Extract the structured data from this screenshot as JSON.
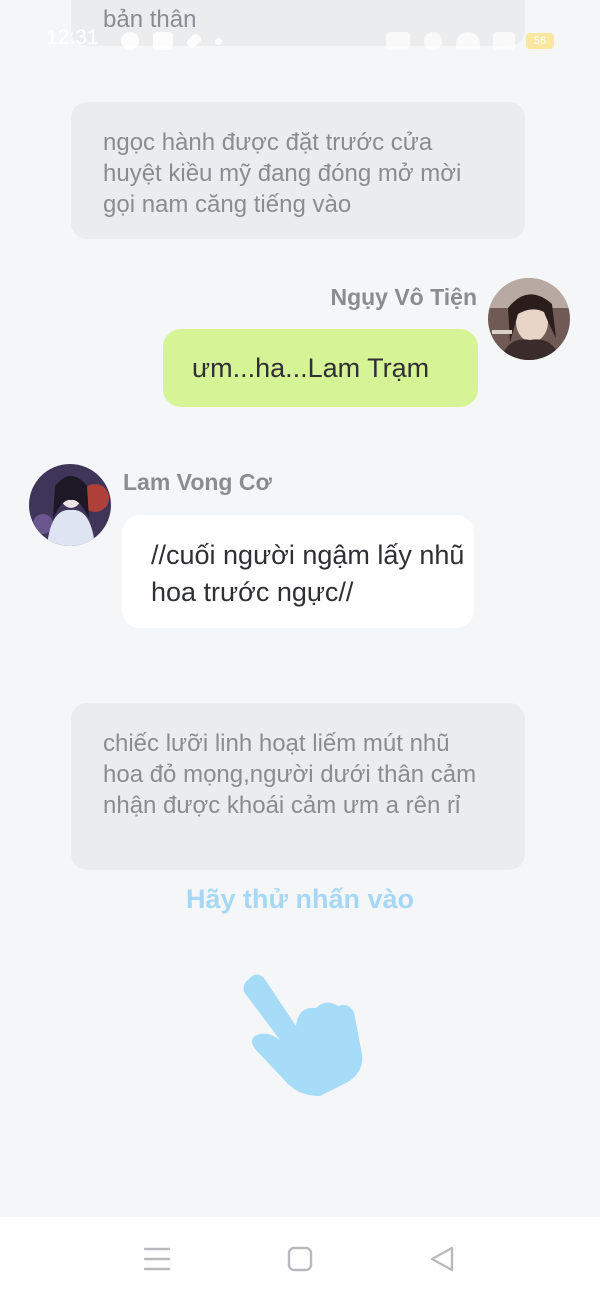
{
  "status_bar": {
    "time": "12:31",
    "battery": "56"
  },
  "messages": [
    {
      "type": "narration",
      "text": "bản thân"
    },
    {
      "type": "narration",
      "text": "ngọc hành được đặt trước cửa huyệt  kiều mỹ đang đóng mở mời gọi nam căng tiếng vào"
    },
    {
      "type": "speech",
      "side": "right",
      "speaker": "Ngụy Vô Tiện",
      "text": "ưm...ha...Lam Trạm"
    },
    {
      "type": "speech",
      "side": "left",
      "speaker": "Lam Vong Cơ",
      "text": "//cuối người ngậm lấy nhũ hoa trước ngực//"
    },
    {
      "type": "narration",
      "text": "chiếc lưỡi linh hoạt liếm mút nhũ hoa đỏ mọng,người dưới thân cảm nhận được khoái cảm ưm a rên rỉ"
    }
  ],
  "hint": "Hãy thử nhấn vào",
  "colors": {
    "background": "#f5f6f8",
    "narration_bg": "#ebecee",
    "green_bubble": "#d6f496",
    "hint": "#a6d8f5"
  }
}
